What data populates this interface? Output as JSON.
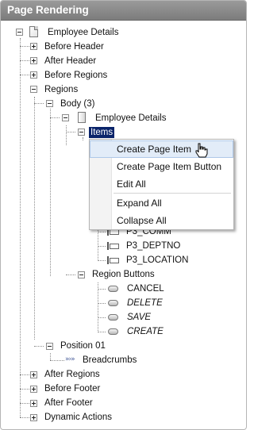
{
  "header": {
    "title": "Page Rendering"
  },
  "tree": {
    "page_label": "Employee Details",
    "before_header": "Before Header",
    "after_header": "After Header",
    "before_regions": "Before Regions",
    "regions": "Regions",
    "body": "Body (3)",
    "region_label": "Employee Details",
    "items": "Items",
    "item_comm": "P3_COMM",
    "item_deptno": "P3_DEPTNO",
    "item_location": "P3_LOCATION",
    "region_buttons": "Region Buttons",
    "btn_cancel": "CANCEL",
    "btn_delete": "DELETE",
    "btn_save": "SAVE",
    "btn_create": "CREATE",
    "position01": "Position 01",
    "breadcrumbs": "Breadcrumbs",
    "after_regions": "After Regions",
    "before_footer": "Before Footer",
    "after_footer": "After Footer",
    "dynamic_actions": "Dynamic Actions"
  },
  "context_menu": {
    "create_page_item": "Create Page Item",
    "create_page_item_button": "Create Page Item Button",
    "edit_all": "Edit All",
    "expand_all": "Expand All",
    "collapse_all": "Collapse All"
  },
  "colors": {
    "header": "#8a8a8a",
    "selection": "#0a246a",
    "menu_hover": "#e2ecf8"
  }
}
